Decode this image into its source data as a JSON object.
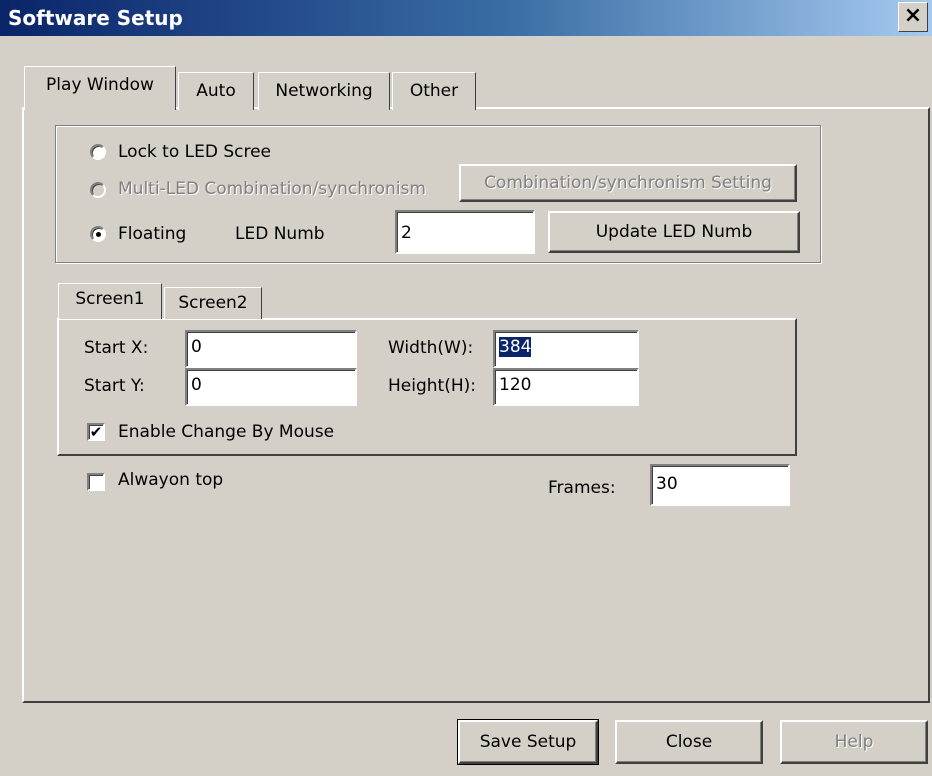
{
  "window": {
    "title": "Software Setup",
    "close_glyph": "×"
  },
  "tabs": [
    "Play Window",
    "Auto",
    "Networking",
    "Other"
  ],
  "mode_group": {
    "lock_label": "Lock to LED Scree",
    "multi_label": "Multi-LED Combination/synchronism",
    "combination_button": "Combination/synchronism Setting",
    "floating_label": "Floating",
    "led_numb_label": "LED Numb",
    "led_numb_value": "2",
    "update_button": "Update LED Numb"
  },
  "screen_tabs": [
    "Screen1",
    "Screen2"
  ],
  "screen": {
    "start_x_label": "Start X:",
    "start_x_value": "0",
    "start_y_label": "Start Y:",
    "start_y_value": "0",
    "width_label": "Width(W):",
    "width_value": "384",
    "height_label": "Height(H):",
    "height_value": "120",
    "mouse_label": "Enable Change By Mouse",
    "mouse_checked": true
  },
  "options": {
    "top_label": "Alwayon top",
    "top_checked": false,
    "frames_label": "Frames:",
    "frames_value": "30"
  },
  "buttons": {
    "save": "Save Setup",
    "close": "Close",
    "help": "Help"
  },
  "icons": {
    "check": "✔"
  }
}
